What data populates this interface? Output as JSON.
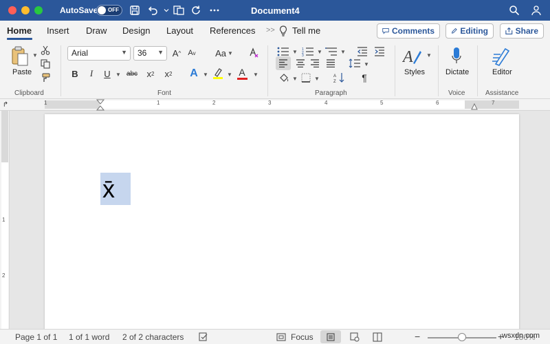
{
  "titlebar": {
    "autosave_label": "AutoSave",
    "autosave_state": "OFF",
    "document_title": "Document4",
    "colors": {
      "bar": "#2b579a",
      "close": "#ff5f57",
      "minimize": "#febc2e",
      "zoom": "#28c840"
    },
    "icons": [
      "save-icon",
      "undo-icon",
      "redo-icon",
      "more-icon",
      "search-icon",
      "share-people-icon"
    ]
  },
  "tabs": {
    "items": [
      "Home",
      "Insert",
      "Draw",
      "Design",
      "Layout",
      "References"
    ],
    "active": "Home",
    "tell_me": "Tell me",
    "comments_label": "Comments",
    "editing_label": "Editing",
    "share_label": "Share"
  },
  "ribbon": {
    "clipboard": {
      "paste_label": "Paste",
      "group_label": "Clipboard"
    },
    "font": {
      "font_name": "Arial",
      "font_size": "36",
      "group_label": "Font",
      "grow_label": "A",
      "shrink_label": "A",
      "case_label": "Aa",
      "bold": "B",
      "italic": "I",
      "underline": "U",
      "strike": "abc",
      "subscript": "x",
      "subscript_mark": "2",
      "superscript": "x",
      "superscript_mark": "2",
      "effects": "A",
      "font_color": "A",
      "highlight_color": "#ffff00",
      "font_color_value": "#e02020"
    },
    "paragraph": {
      "group_label": "Paragraph",
      "pilcrow": "¶"
    },
    "styles": {
      "label": "Styles"
    },
    "voice": {
      "dictate_label": "Dictate",
      "group_label": "Voice"
    },
    "assistance": {
      "editor_label": "Editor",
      "group_label": "Assistance"
    }
  },
  "ruler": {
    "numbers": [
      "1",
      "1",
      "2",
      "3",
      "4",
      "5",
      "6",
      "7"
    ]
  },
  "vruler": {
    "numbers": [
      "1",
      "1",
      "2"
    ]
  },
  "document": {
    "selected_text": "x̄"
  },
  "status": {
    "page": "Page 1 of 1",
    "words": "1 of 1 word",
    "characters": "2 of 2 characters",
    "focus_label": "Focus",
    "zoom_value": "180%",
    "watermark": "wsxdn.com"
  }
}
